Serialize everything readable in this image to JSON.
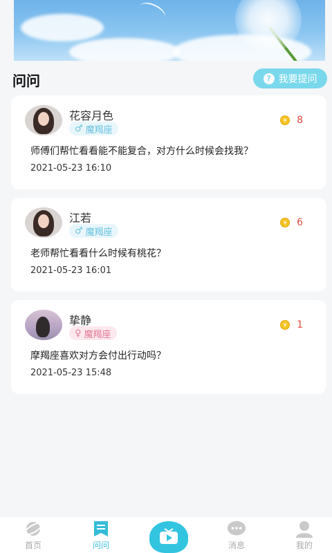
{
  "section": {
    "title": "问问",
    "ask_button": "我要提问",
    "ask_icon": "?"
  },
  "questions": [
    {
      "name": "花容月色",
      "sign": "魔羯座",
      "gender": "male",
      "coins": "8",
      "text": "师傅们帮忙看看能不能复合，对方什么时候会找我？",
      "time": "2021-05-23 16:10"
    },
    {
      "name": "江若",
      "sign": "魔羯座",
      "gender": "male",
      "coins": "6",
      "text": "老师帮忙看看什么时候有桃花？",
      "time": "2021-05-23 16:01"
    },
    {
      "name": "挚静",
      "sign": "魔羯座",
      "gender": "female",
      "coins": "1",
      "text": "摩羯座喜欢对方会付出行动吗？",
      "time": "2021-05-23 15:48"
    }
  ],
  "tabbar": {
    "home": "首页",
    "ask": "问问",
    "messages": "消息",
    "mine": "我的"
  },
  "colors": {
    "accent": "#33c4e0",
    "coin_text": "#e0483e",
    "male_tag": "#6bc2de",
    "female_tag": "#e27a97"
  },
  "icons": {
    "coin_symbol": "¥",
    "male_symbol": "♂",
    "female_symbol": "♀"
  }
}
